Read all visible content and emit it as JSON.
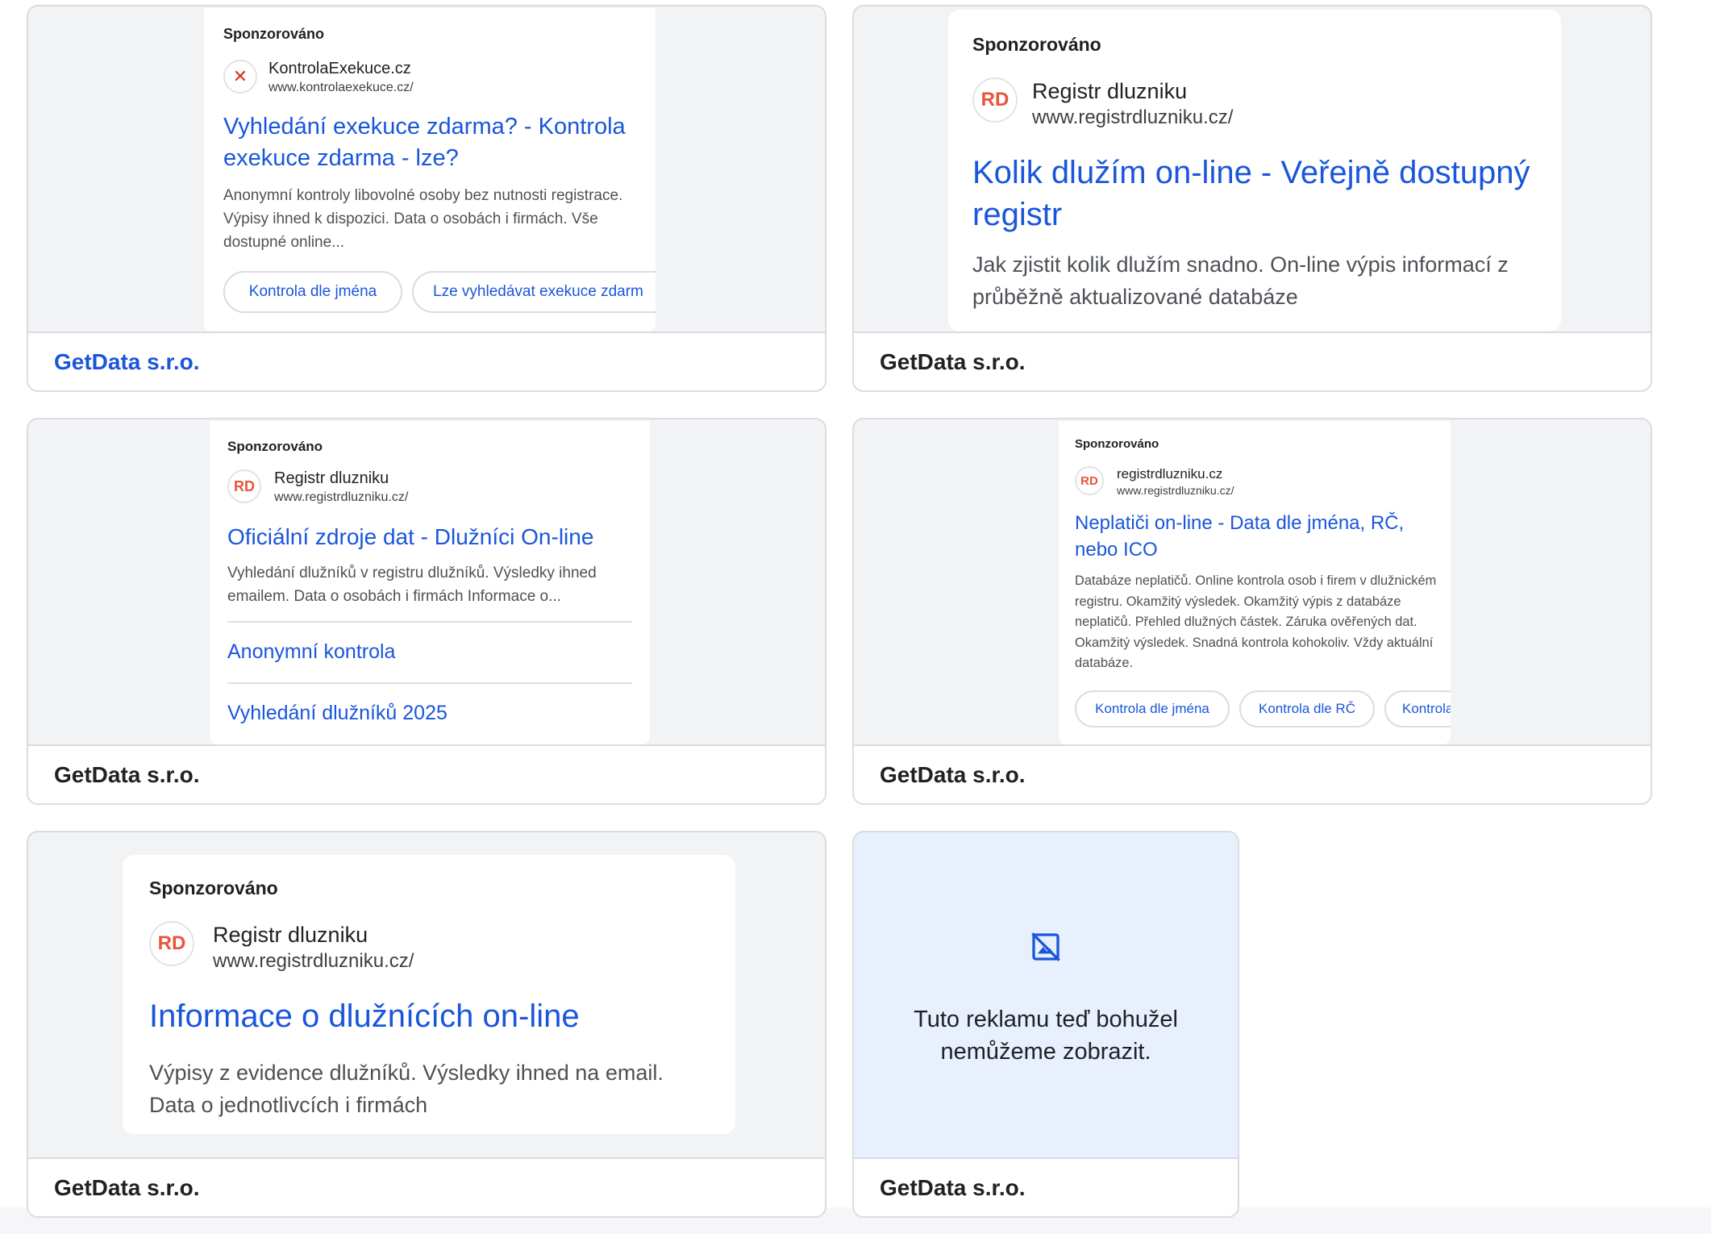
{
  "sponsored_label": "Sponzorováno",
  "advertiser": "GetData s.r.o.",
  "ads": [
    {
      "site_name": "KontrolaExekuce.cz",
      "site_url": "www.kontrolaexekuce.cz/",
      "favicon": "close-x-icon",
      "headline": "Vyhledání exekuce zdarma? - Kontrola exekuce zdarma - lze?",
      "description": "Anonymní kontroly libovolné osoby bez nutnosti registrace. Výpisy ihned k dispozici. Data o osobách i firmách. Vše dostupné online...",
      "chips": [
        "Kontrola dle jména",
        "Lze vyhledávat exekuce zdarm"
      ]
    },
    {
      "site_name": "Registr dluzniku",
      "site_url": "www.registrdluzniku.cz/",
      "favicon": "RD",
      "headline": "Kolik dlužím on-line - Veřejně dostupný registr",
      "description": "Jak zjistit kolik dlužím snadno. On-line výpis informací z průběžně aktualizované databáze"
    },
    {
      "site_name": "Registr dluzniku",
      "site_url": "www.registrdluzniku.cz/",
      "favicon": "RD",
      "headline": "Oficiální zdroje dat - Dlužníci On-line",
      "description": "Vyhledání dlužníků v registru dlužníků. Výsledky ihned emailem. Data o osobách i firmách Informace o...",
      "sitelinks": [
        "Anonymní kontrola",
        "Vyhledání dlužníků 2025"
      ]
    },
    {
      "site_name": "registrdluzniku.cz",
      "site_url": "www.registrdluzniku.cz/",
      "favicon": "RD",
      "headline": "Neplatiči on-line - Data dle jména, RČ, nebo ICO",
      "description": "Databáze neplatičů. Online kontrola osob i firem v dlužnickém registru. Okamžitý výsledek. Okamžitý výpis z databáze neplatičů. Přehled dlužných částek. Záruka ověřených dat. Okamžitý výsledek. Snadná kontrola kohokoliv. Vždy aktuální databáze.",
      "chips": [
        "Kontrola dle jména",
        "Kontrola dle RČ",
        "Kontrola"
      ]
    },
    {
      "site_name": "Registr dluzniku",
      "site_url": "www.registrdluzniku.cz/",
      "favicon": "RD",
      "headline": "Informace o dlužnících on-line",
      "description": "Výpisy z evidence dlužníků. Výsledky ihned na email. Data o jednotlivcích i firmách"
    }
  ],
  "unavailable": {
    "icon": "image-unavailable-icon",
    "line1": "Tuto reklamu teď bohužel",
    "line2": "nemůžeme zobrazit."
  },
  "colors": {
    "link_blue": "#1a56db",
    "favicon_red": "#e8553b",
    "card_bg": "#f1f3f4",
    "unavailable_bg": "#e8f0fe"
  }
}
